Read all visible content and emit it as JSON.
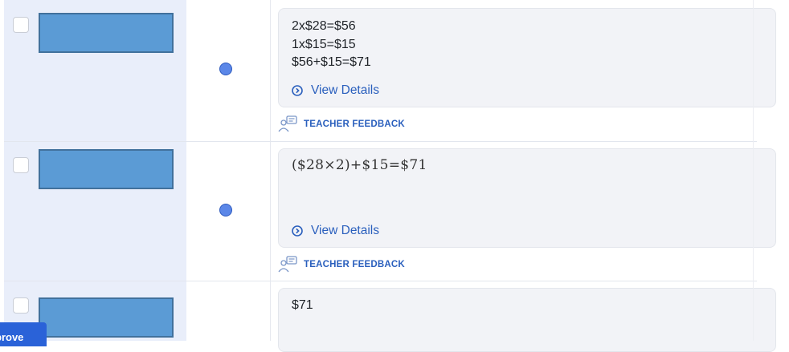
{
  "rows": [
    {
      "response_lines": [
        "2x$28=$56",
        "1x$15=$15",
        "$56+$15=$71"
      ],
      "view_details": "View Details",
      "feedback_label": "TEACHER FEEDBACK",
      "status": "submitted"
    },
    {
      "response_math": "($28×2)+$15=$71",
      "view_details": "View Details",
      "feedback_label": "TEACHER FEEDBACK",
      "status": "submitted"
    },
    {
      "response_lines": [
        "$71"
      ]
    }
  ],
  "approve_button": {
    "label": "prove"
  },
  "colors": {
    "accent": "#2a5fbd",
    "status_dot": "#5b87e8",
    "name_redaction": "#5b9bd5",
    "approve": "#2a62d8"
  },
  "icons": [
    "chevron-circle-icon",
    "teacher-feedback-icon"
  ]
}
